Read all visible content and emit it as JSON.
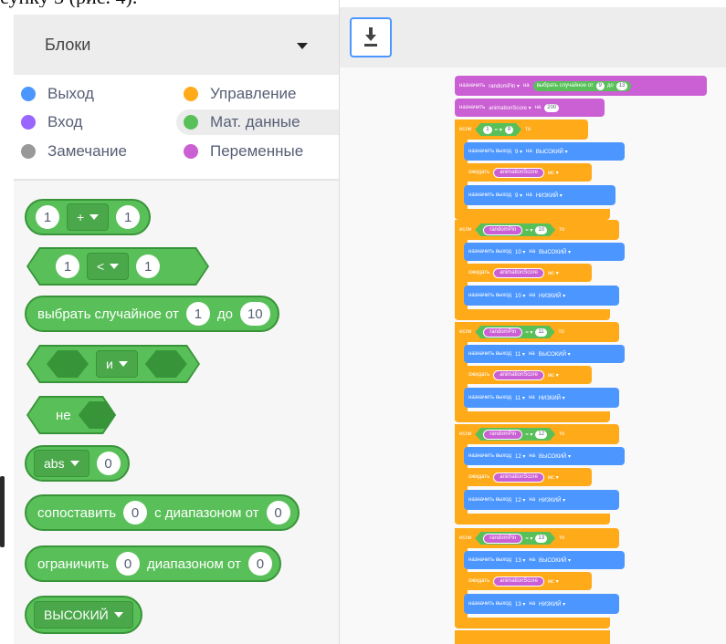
{
  "cut_text": "сунку 3 (рис. 4).",
  "selector": {
    "label": "Блоки"
  },
  "categories": [
    {
      "label": "Выход",
      "color": "#4c97ff"
    },
    {
      "label": "Управление",
      "color": "#ffab19"
    },
    {
      "label": "Вход",
      "color": "#9966ff"
    },
    {
      "label": "Мат. данные",
      "color": "#59c059"
    },
    {
      "label": "Замечание",
      "color": "#999999"
    },
    {
      "label": "Переменные",
      "color": "#cb5fd4"
    }
  ],
  "blocks": {
    "arith": {
      "left": "1",
      "op": "+",
      "right": "1"
    },
    "compare": {
      "left": "1",
      "op": "<",
      "right": "1"
    },
    "random": {
      "text": "выбрать случайное от",
      "from": "1",
      "to_label": "до",
      "to": "10"
    },
    "and": {
      "op": "и"
    },
    "not": {
      "text": "не"
    },
    "abs": {
      "op": "abs",
      "value": "0"
    },
    "map": {
      "text": "сопоставить",
      "value": "0",
      "range_label": "с диапазоном от",
      "from": "0"
    },
    "constrain": {
      "text": "ограничить",
      "value": "0",
      "range_label": "диапазоном от",
      "from": "0"
    },
    "high": {
      "label": "ВЫСОКИЙ"
    }
  },
  "script": {
    "set1": {
      "kw": "назначить",
      "var": "randomPin",
      "to": "на",
      "fn": "выбрать случайное от",
      "from": "9",
      "to_label": "до",
      "to_val": "13"
    },
    "set2": {
      "kw": "назначить",
      "var": "animationScore",
      "to": "на",
      "value": "200"
    },
    "if_kw": "если",
    "then_kw": "то",
    "eq": "=",
    "first_cond_left": "1",
    "out_kw": "назначить выход",
    "high": "ВЫСОКИЙ",
    "low": "НИЗКИЙ",
    "na": "на",
    "wait_kw": "ожидать",
    "ms": "мс",
    "var_score": "animationScore",
    "var_pin": "randomPin",
    "pins": [
      "9",
      "10",
      "11",
      "12",
      "13"
    ]
  },
  "colors": {
    "math": "#59c059",
    "control": "#ffab19",
    "variables": "#cb5fd4",
    "output": "#4c97ff"
  }
}
